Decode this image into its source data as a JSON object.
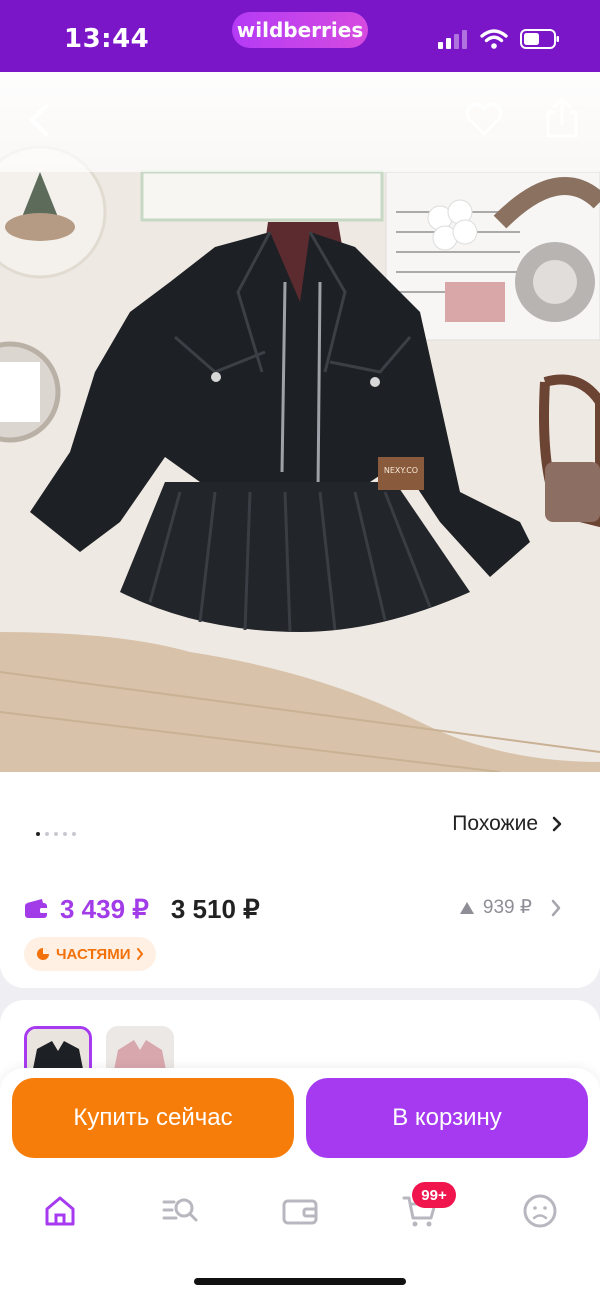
{
  "status_bar": {
    "time": "13:44",
    "brand": "wildberries",
    "icons": [
      "signal-icon",
      "wifi-icon",
      "battery-icon"
    ]
  },
  "product_nav": {
    "icons": [
      "back-arrow-icon",
      "heart-icon",
      "share-icon"
    ]
  },
  "product_info": {
    "gallery_dots": 5,
    "gallery_active": 0,
    "similar_label": "Похожие",
    "price_wallet": "3 439 ₽",
    "price_regular": "3 510 ₽",
    "price_extra": "939 ₽",
    "installment_label": "ЧАСТЯМИ"
  },
  "actions": {
    "buy_now": "Купить сейчас",
    "add_to_cart": "В корзину"
  },
  "tab_bar": {
    "items": [
      "home-icon",
      "catalog-search-icon",
      "wallet-icon",
      "cart-icon",
      "profile-icon"
    ],
    "cart_badge": "99+",
    "active": "home-icon"
  },
  "colors": {
    "brand_purple": "#7a15c8",
    "accent_purple": "#a53af0",
    "buy_orange": "#f77d0b",
    "badge_red": "#f0164d"
  }
}
